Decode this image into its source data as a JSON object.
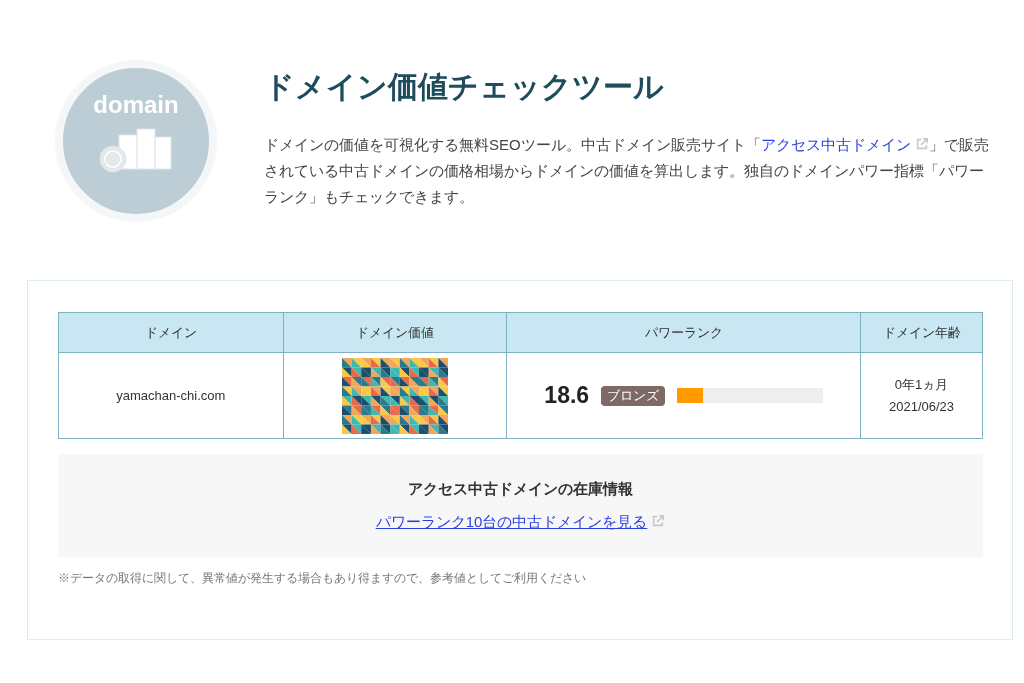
{
  "logo": {
    "text": "domain"
  },
  "title": "ドメイン価値チェックツール",
  "description": {
    "before": "ドメインの価値を可視化する無料SEOツール。中古ドメイン販売サイト「",
    "link": "アクセス中古ドメイン",
    "after": "」で販売されている中古ドメインの価格相場からドメインの価値を算出します。独自のドメインパワー指標「パワーランク」もチェックできます。"
  },
  "table": {
    "columns": [
      "ドメイン",
      "ドメイン価値",
      "パワーランク",
      "ドメイン年齢"
    ],
    "row": {
      "domain": "yamachan-chi.com",
      "power_rank": "18.6",
      "rank_badge": "ブロンズ",
      "level": 0.18,
      "age": "0年1ヵ月",
      "date": "2021/06/23"
    }
  },
  "stock": {
    "heading": "アクセス中古ドメインの在庫情報",
    "link": "パワーランク10台の中古ドメインを見る"
  },
  "note": "※データの取得に関して、異常値が発生する場合もあり得ますので、参考値としてご利用ください"
}
